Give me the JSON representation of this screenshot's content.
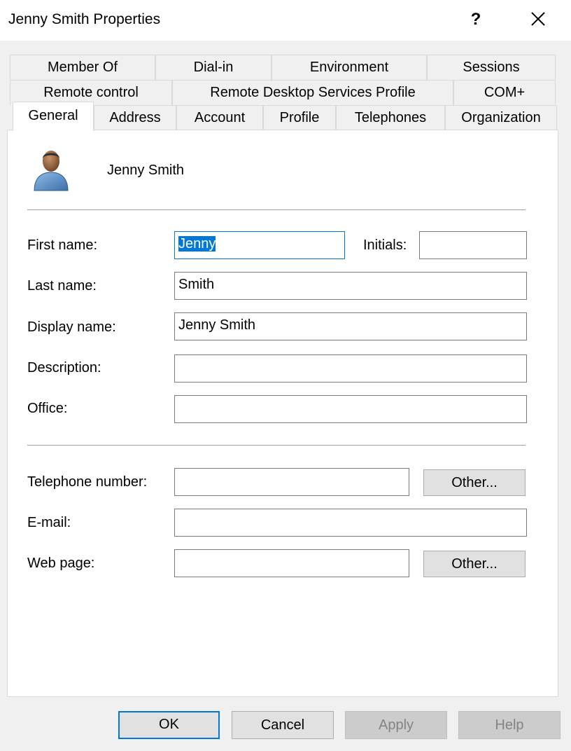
{
  "window": {
    "title": "Jenny Smith Properties",
    "help_label": "?",
    "close_icon": "close-icon"
  },
  "tabs": {
    "row1": [
      "Member Of",
      "Dial-in",
      "Environment",
      "Sessions"
    ],
    "row2": [
      "Remote control",
      "Remote Desktop Services Profile",
      "COM+"
    ],
    "row3": [
      "General",
      "Address",
      "Account",
      "Profile",
      "Telephones",
      "Organization"
    ],
    "active": "General"
  },
  "general": {
    "avatar_icon": "user-avatar-icon",
    "user_display": "Jenny Smith",
    "first_name": {
      "label": "First name:",
      "value": "Jenny"
    },
    "initials": {
      "label": "Initials:",
      "value": ""
    },
    "last_name": {
      "label": "Last name:",
      "value": "Smith"
    },
    "display_name": {
      "label": "Display name:",
      "value": "Jenny Smith"
    },
    "description": {
      "label": "Description:",
      "value": ""
    },
    "office": {
      "label": "Office:",
      "value": ""
    },
    "telephone": {
      "label": "Telephone number:",
      "value": "",
      "other_label": "Other..."
    },
    "email": {
      "label": "E-mail:",
      "value": ""
    },
    "web_page": {
      "label": "Web page:",
      "value": "",
      "other_label": "Other..."
    }
  },
  "buttons": {
    "ok": "OK",
    "cancel": "Cancel",
    "apply": "Apply",
    "help": "Help"
  },
  "colors": {
    "accent": "#0078d7",
    "dialog_bg": "#f0f0f0",
    "panel_bg": "#ffffff"
  }
}
